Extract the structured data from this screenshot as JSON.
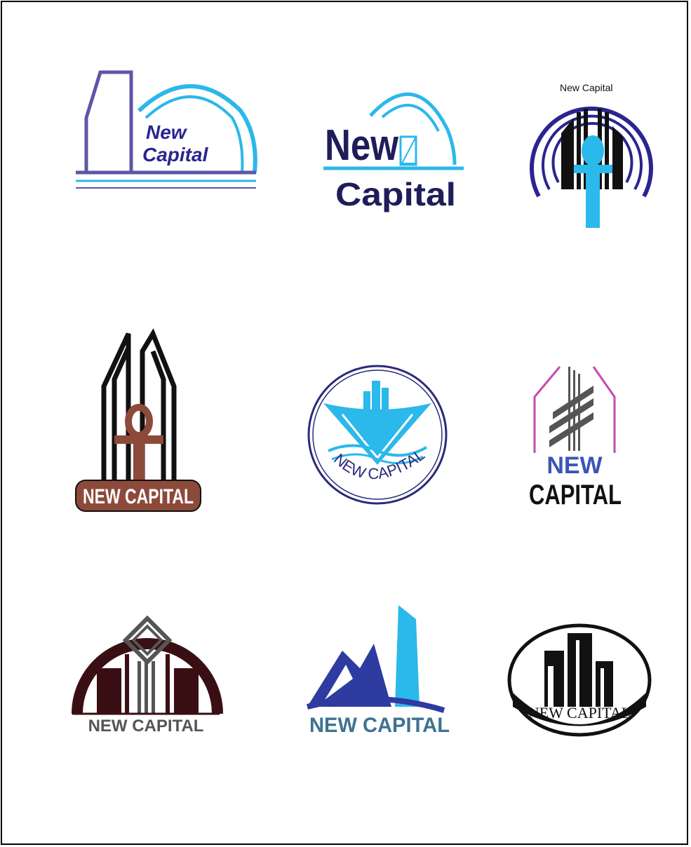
{
  "logos": [
    {
      "line1": "New",
      "line2": "Capital",
      "colors": {
        "primary": "#5d56a8",
        "accent": "#2bb8ea"
      }
    },
    {
      "line1": "New",
      "line2": "Capital",
      "colors": {
        "primary": "#1f1d59",
        "accent": "#2bb8ea"
      }
    },
    {
      "text": "New Capital",
      "colors": {
        "primary": "#2a2590",
        "accent": "#2bb8ea",
        "dark": "#111111"
      }
    },
    {
      "text": "NEW CAPITAL",
      "colors": {
        "primary": "#8c4a3a",
        "dark": "#111111"
      }
    },
    {
      "text": "NEW CAPITAL",
      "colors": {
        "primary": "#2a2a7a",
        "accent": "#2bb8ea"
      }
    },
    {
      "line1": "NEW",
      "line2": "CAPITAL",
      "colors": {
        "primary": "#3b55b5",
        "accent": "#c44bb0",
        "dark": "#555555"
      }
    },
    {
      "text": "NEW CAPITAL",
      "colors": {
        "primary": "#3a0f14",
        "dark": "#555555"
      }
    },
    {
      "text": "NEW CAPITAL",
      "colors": {
        "primary": "#2e3ba0",
        "accent": "#2bb8ea",
        "text": "#3d7390"
      }
    },
    {
      "text": "NEW CAPITAL",
      "colors": {
        "primary": "#111111"
      }
    }
  ]
}
